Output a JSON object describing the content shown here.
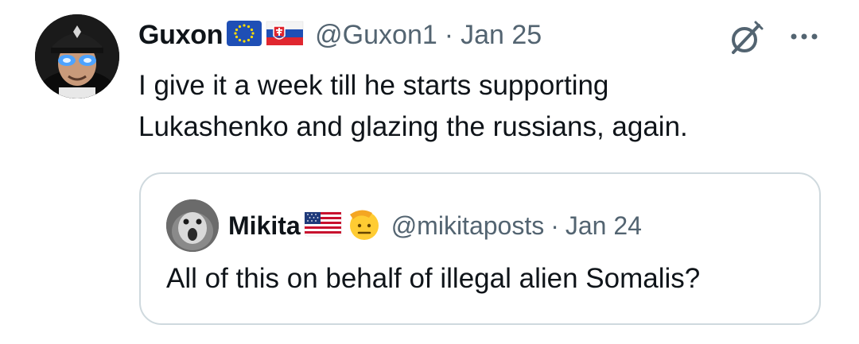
{
  "tweet": {
    "author": {
      "display_name": "Guxon",
      "flags": [
        "eu-flag",
        "slovakia-flag"
      ],
      "handle": "@Guxon1",
      "separator": "·",
      "date": "Jan 25"
    },
    "text_lines": [
      "I give it a week till he starts supporting",
      "Lukashenko and glazing the russians, again."
    ],
    "icons": [
      "grok-icon",
      "more-options-icon"
    ]
  },
  "quote": {
    "author": {
      "display_name": "Mikita",
      "flags": [
        "usa-flag",
        "saluting-face-emoji"
      ],
      "handle": "@mikitaposts",
      "separator": "·",
      "date": "Jan 24"
    },
    "text": "All of this on behalf of illegal alien Somalis?"
  },
  "colors": {
    "primary_text": "#0f1419",
    "secondary_text": "#536471",
    "border": "#cfd9de"
  }
}
